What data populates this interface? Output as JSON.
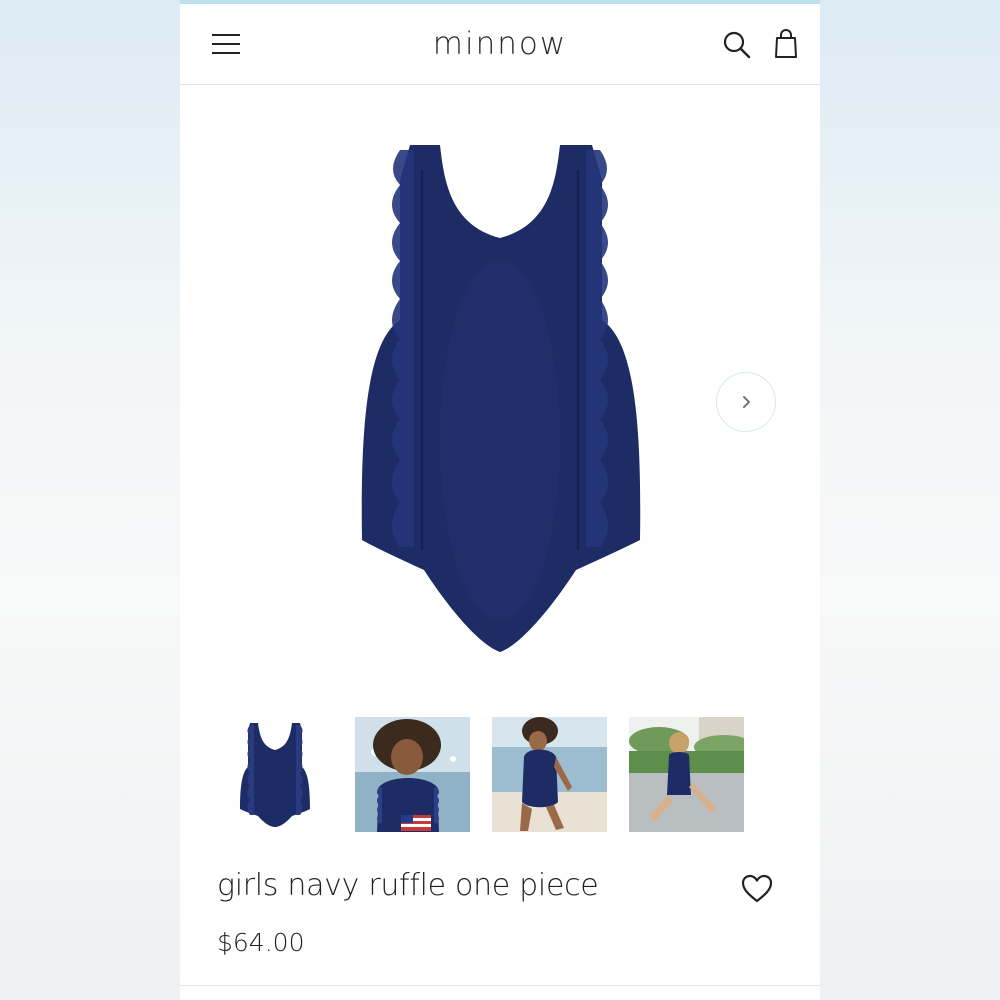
{
  "header": {
    "logo": "minnow",
    "icons": {
      "menu": "hamburger-menu-icon",
      "search": "search-icon",
      "cart": "shopping-bag-icon"
    }
  },
  "product": {
    "title": "girls navy ruffle one piece",
    "price": "$64.00",
    "color": "#1e2c66"
  },
  "gallery": {
    "next_icon": "chevron-right-icon",
    "thumbnails": [
      {
        "name": "swimsuit-flat-thumb"
      },
      {
        "name": "child-with-flag-thumb"
      },
      {
        "name": "child-at-beach-thumb"
      },
      {
        "name": "child-sitting-poolside-thumb"
      }
    ]
  },
  "favorite_icon": "heart-outline-icon"
}
